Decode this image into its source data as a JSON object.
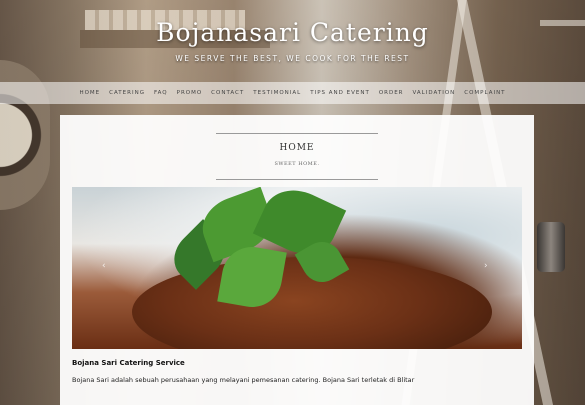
{
  "header": {
    "site_title": "Bojanasari Catering",
    "tagline": "WE SERVE THE BEST, WE COOK FOR THE REST"
  },
  "nav": {
    "items": [
      {
        "label": "HOME"
      },
      {
        "label": "CATERING"
      },
      {
        "label": "FAQ"
      },
      {
        "label": "PROMO"
      },
      {
        "label": "CONTACT"
      },
      {
        "label": "TESTIMONIAL"
      },
      {
        "label": "TIPS AND EVENT"
      },
      {
        "label": "ORDER"
      },
      {
        "label": "VALIDATION"
      },
      {
        "label": "COMPLAINT"
      }
    ]
  },
  "page": {
    "title": "HOME",
    "subtitle": "SWEET HOME."
  },
  "slider": {
    "prev_label": "‹",
    "next_label": "›"
  },
  "content": {
    "caption_title": "Bojana Sari Catering Service",
    "caption_text": "Bojana Sari adalah sebuah perusahaan yang melayani pemesanan catering. Bojana Sari terletak di Blitar"
  },
  "colors": {
    "nav_bar": "#ffffff",
    "panel": "#ffffff",
    "title_text": "#ffffff"
  }
}
